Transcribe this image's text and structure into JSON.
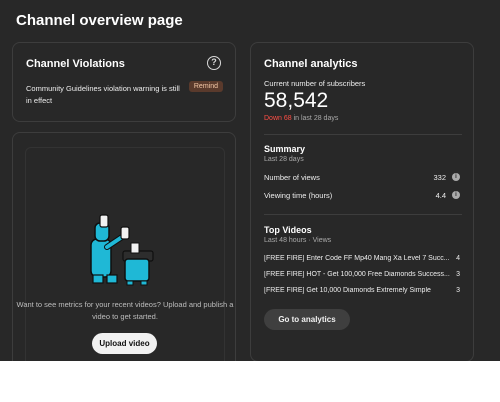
{
  "page": {
    "title": "Channel overview page"
  },
  "violations": {
    "title": "Channel Violations",
    "message": "Community Guidelines violation warning is still in effect",
    "badge": "Remind",
    "help_icon": "question-circle-icon"
  },
  "videos_empty": {
    "message": "Want to see metrics for your recent videos? Upload and publish a video to get started.",
    "upload_label": "Upload video",
    "illustration": "creator-illustration"
  },
  "analytics": {
    "title": "Channel analytics",
    "subscribers_label": "Current number of subscribers",
    "subscribers_count": "58,542",
    "change_down": "Down 68",
    "change_rest": " in last 28 days",
    "summary": {
      "title": "Summary",
      "period": "Last 28 days",
      "metrics": [
        {
          "label": "Number of views",
          "value": "332",
          "icon": "info-icon"
        },
        {
          "label": "Viewing time (hours)",
          "value": "4.4",
          "icon": "info-icon"
        }
      ]
    },
    "top_videos": {
      "title": "Top Videos",
      "period": "Last 48 hours · Views",
      "items": [
        {
          "title": "[FREE FIRE] Enter Code FF Mp40 Mang Xa Level 7 Succ...",
          "views": "4"
        },
        {
          "title": "[FREE FIRE] HOT - Get 100,000 Free Diamonds Success...",
          "views": "3"
        },
        {
          "title": "[FREE FIRE] Get 10,000 Diamonds Extremely Simple",
          "views": "3"
        }
      ]
    },
    "go_label": "Go to analytics"
  },
  "colors": {
    "background": "#282828",
    "down": "#ff4e45",
    "badge_bg": "#5a3a2c",
    "accent_illustration": "#1fb8d6"
  }
}
